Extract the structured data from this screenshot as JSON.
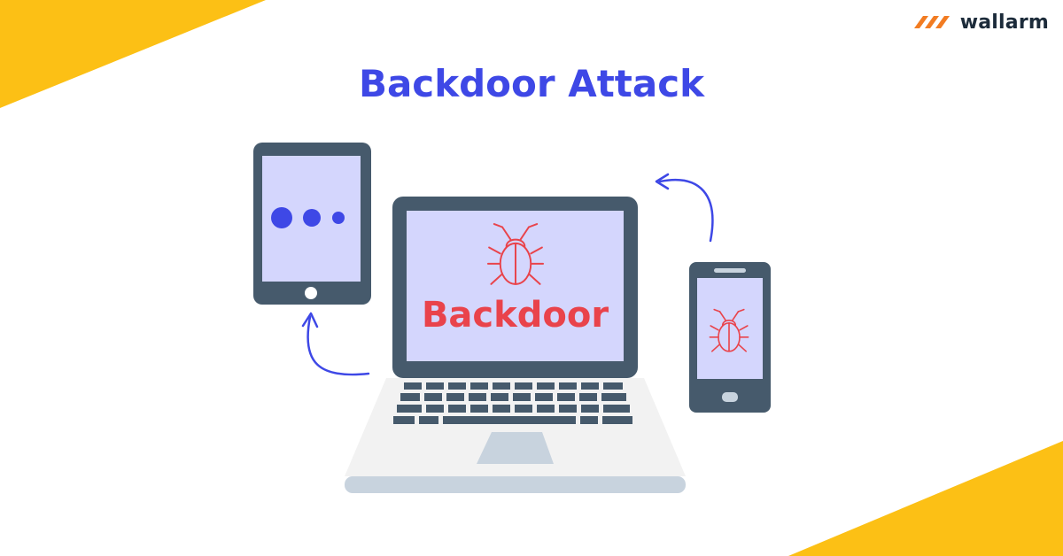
{
  "title": "Backdoor Attack",
  "brand": {
    "name": "wallarm",
    "logo_icon": "wallarm-logo-icon"
  },
  "laptop": {
    "screen_label": "Backdoor",
    "icon": "bug-icon"
  },
  "tablet": {
    "icon": "loading-dots-icon"
  },
  "phone": {
    "icon": "bug-icon"
  },
  "colors": {
    "accent_yellow": "#fcc015",
    "title_blue": "#3e48e6",
    "device_frame": "#465a6c",
    "screen_fill": "#d4d6fd",
    "alert_red": "#e9434b",
    "brand_orange": "#f27c22"
  }
}
